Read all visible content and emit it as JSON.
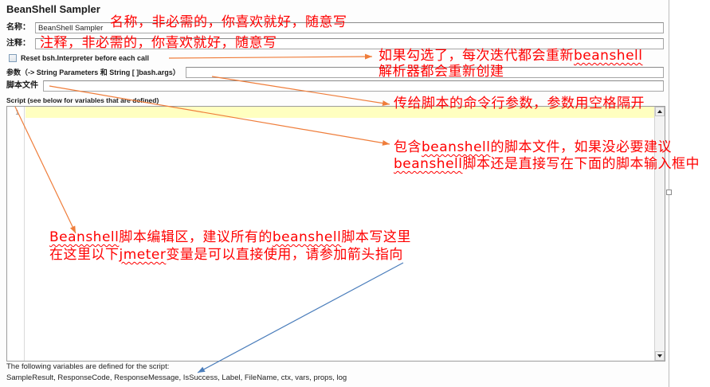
{
  "window": {
    "title": "BeanShell Sampler"
  },
  "form": {
    "name": {
      "label": "名称：",
      "value": "BeanShell Sampler"
    },
    "comments": {
      "label": "注释：",
      "value": ""
    },
    "reset_interpreter": {
      "label": "Reset bsh.Interpreter before each call",
      "checked": false
    },
    "parameters": {
      "label": "参数（-> String Parameters 和 String [ ]bash.args）",
      "value": ""
    },
    "script_file": {
      "label": "脚本文件",
      "value": ""
    }
  },
  "editor": {
    "label": "Script (see below for variables that are defined)",
    "line_numbers": [
      "1"
    ],
    "content": ""
  },
  "variables_help": {
    "intro": "The following variables are defined for the script:",
    "list": "SampleResult, ResponseCode, ResponseMessage, IsSuccess, Label, FileName, ctx, vars, props, log"
  },
  "annotations": {
    "name_note": "名称，非必需的，你喜欢就好，随意写",
    "comment_note": "注释，非必需的，你喜欢就好，随意写",
    "reset_note": [
      [
        "如果勾选了，每次迭代都会重新",
        "beanshell"
      ],
      [
        "解析器都会重新创建"
      ]
    ],
    "parameters_note": "传给脚本的命令行参数，参数用空格隔开",
    "script_file_note": [
      [
        "包含",
        "beanshell",
        "的脚本文件，如果没必要建议"
      ],
      [
        "beanshell",
        "脚本还是直接写在下面的脚本输入框中"
      ]
    ],
    "editor_note": [
      [
        "Beanshell",
        "脚本编辑区，建议所有的",
        "beanshell",
        "脚本写这里"
      ],
      [
        "在这里以下",
        "jmeter",
        "变量是可以直接使用，请参加箭头指向"
      ]
    ]
  },
  "icons": {
    "scroll_up": "scroll-up-arrow-icon",
    "scroll_down": "scroll-down-arrow-icon"
  },
  "colors": {
    "annotation_text": "#ff0000",
    "callout_arrow": "#ef7d3a",
    "pointer_arrow": "#4a7dbb",
    "current_line_highlight": "#ffffc0"
  }
}
